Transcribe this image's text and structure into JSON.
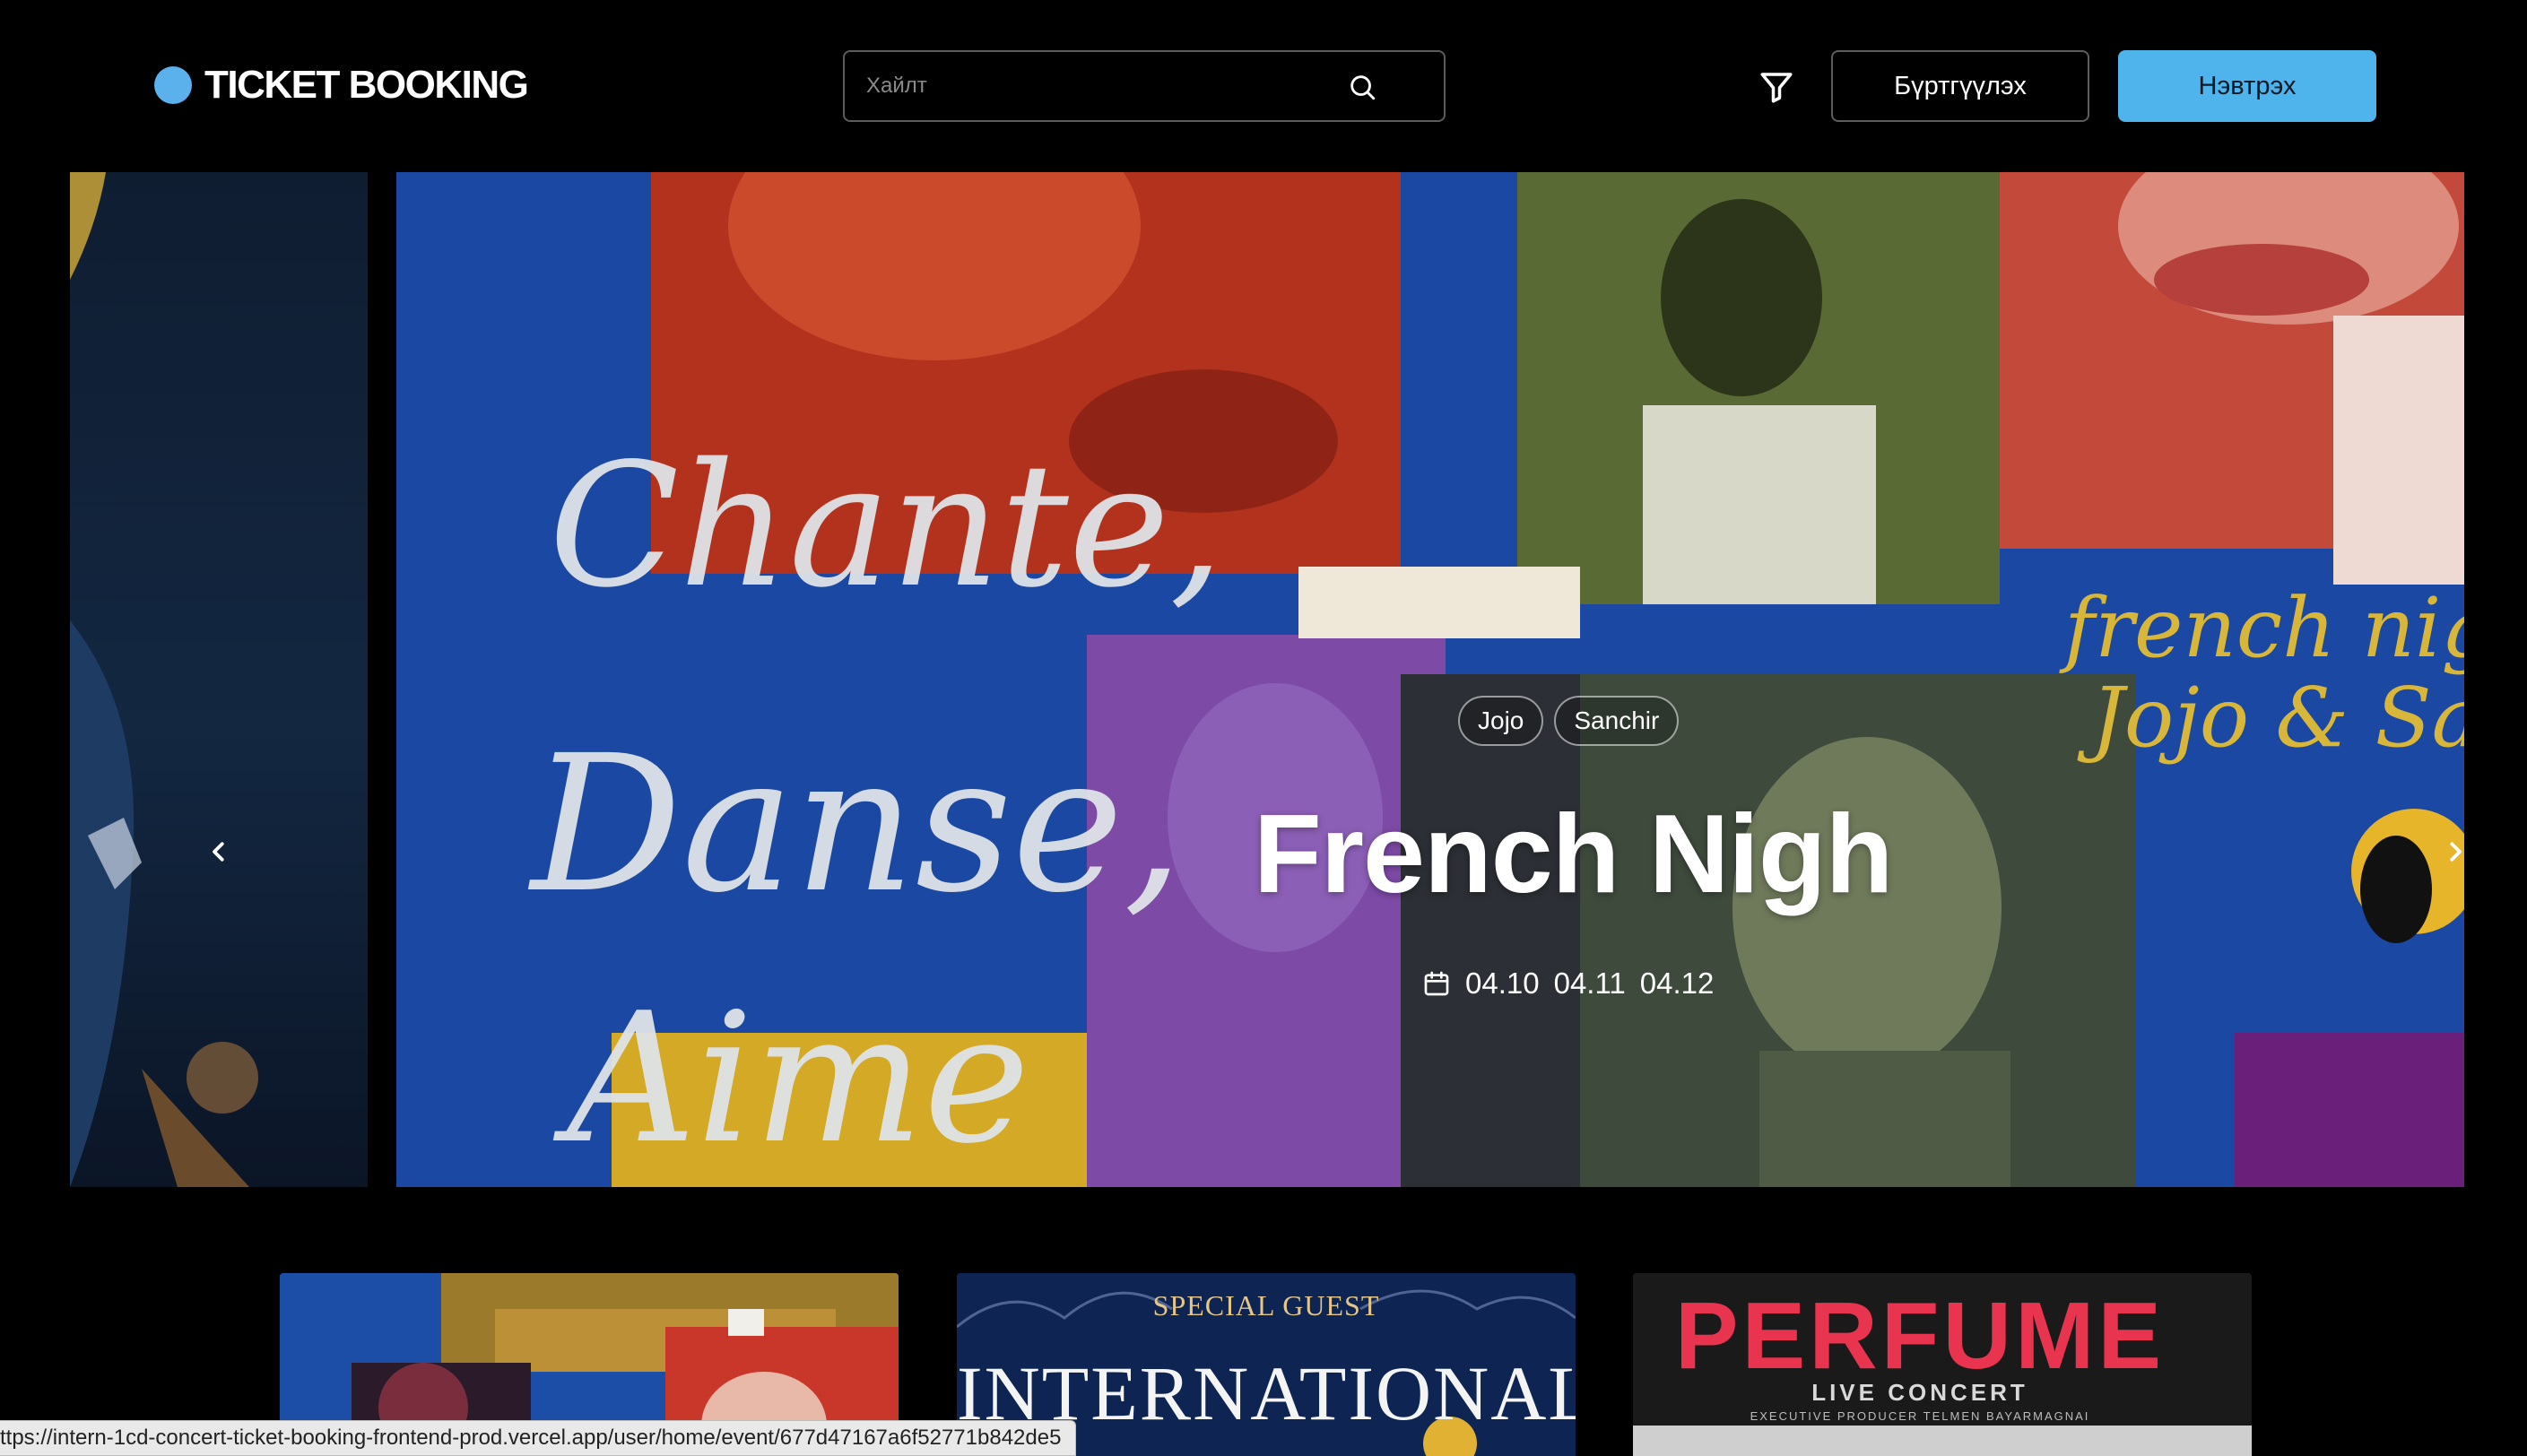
{
  "header": {
    "logo_text": "TICKET BOOKING",
    "search_placeholder": "Хайлт",
    "register_label": "Бүртгүүлэх",
    "login_label": "Нэвтрэх"
  },
  "carousel": {
    "tags": [
      "Jojo",
      "Sanchir"
    ],
    "title": "French Nigh",
    "dates": [
      "04.10",
      "04.11",
      "04.12"
    ],
    "poster_script": [
      "Chante,",
      "Danse,",
      "Aime"
    ],
    "poster_corner": [
      "french night",
      "Jojo & San"
    ]
  },
  "cards": [
    {
      "label": "french-night-card"
    },
    {
      "special": "SPECIAL GUEST",
      "title": "INTERNATIONAL"
    },
    {
      "title": "PERFUME",
      "subtitle": "LIVE CONCERT",
      "note": "EXECUTIVE PRODUCER TELMEN BAYARMAGNAI"
    }
  ],
  "status_bar": {
    "url": "ttps://intern-1cd-concert-ticket-booking-frontend-prod.vercel.app/user/home/event/677d47167a6f52771b842de5"
  },
  "colors": {
    "accent": "#4fb4ec",
    "logo_dot": "#5ab1ec",
    "poster_blue": "#1b48a2"
  }
}
